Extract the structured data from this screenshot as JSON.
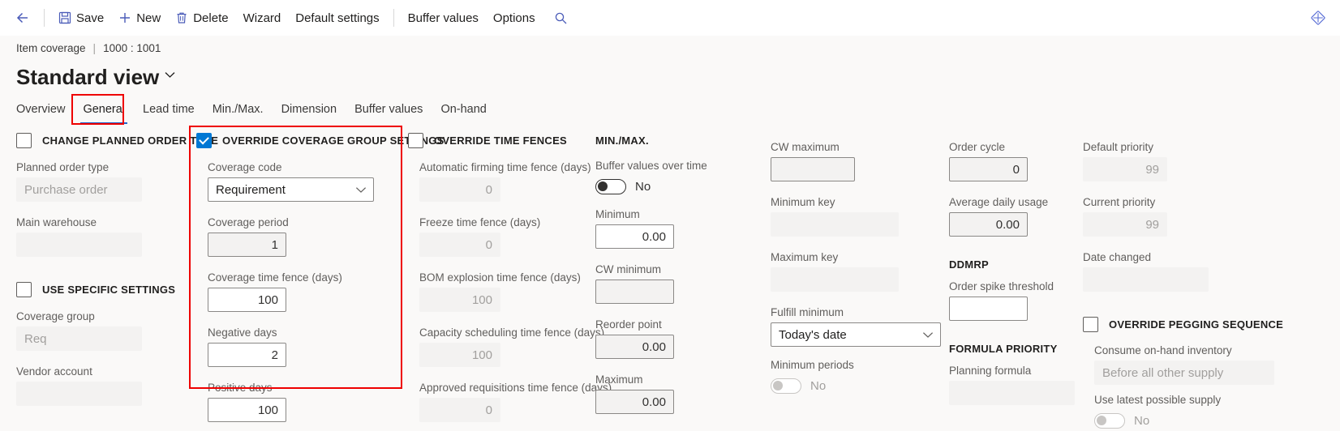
{
  "toolbar": {
    "back_icon": "back-arrow-icon",
    "save_label": "Save",
    "new_label": "New",
    "delete_label": "Delete",
    "wizard_label": "Wizard",
    "default_settings_label": "Default settings",
    "buffer_values_label": "Buffer values",
    "options_label": "Options",
    "search_icon": "search-icon",
    "personalize_icon": "diamond-personalize-icon"
  },
  "header": {
    "breadcrumb_entity": "Item coverage",
    "breadcrumb_sep": "|",
    "breadcrumb_record": "1000 : 1001",
    "page_title": "Standard view",
    "page_title_chevron": "chevron-down-icon"
  },
  "tabs": [
    {
      "label": "Overview",
      "selected": false
    },
    {
      "label": "General",
      "selected": true
    },
    {
      "label": "Lead time",
      "selected": false
    },
    {
      "label": "Min./Max.",
      "selected": false
    },
    {
      "label": "Dimension",
      "selected": false
    },
    {
      "label": "Buffer values",
      "selected": false
    },
    {
      "label": "On-hand",
      "selected": false
    }
  ],
  "col1": {
    "group_title": "CHANGE PLANNED ORDER TYPE",
    "group_checked": false,
    "planned_order_type": {
      "label": "Planned order type",
      "value": "Purchase order"
    },
    "main_warehouse": {
      "label": "Main warehouse",
      "value": ""
    },
    "group2_title": "USE SPECIFIC SETTINGS",
    "group2_checked": false,
    "coverage_group": {
      "label": "Coverage group",
      "value": "Req"
    },
    "vendor_account": {
      "label": "Vendor account",
      "value": ""
    }
  },
  "col2": {
    "group_title": "OVERRIDE COVERAGE GROUP SETTINGS",
    "group_checked": true,
    "coverage_code": {
      "label": "Coverage code",
      "value": "Requirement"
    },
    "coverage_period": {
      "label": "Coverage period",
      "value": "1"
    },
    "coverage_time_fence": {
      "label": "Coverage time fence (days)",
      "value": "100"
    },
    "negative_days": {
      "label": "Negative days",
      "value": "2"
    },
    "positive_days": {
      "label": "Positive days",
      "value": "100"
    }
  },
  "col3": {
    "group_title": "OVERRIDE TIME FENCES",
    "group_checked": false,
    "automatic_firming": {
      "label": "Automatic firming time fence (days)",
      "value": "0"
    },
    "freeze": {
      "label": "Freeze time fence (days)",
      "value": "0"
    },
    "bom_explosion": {
      "label": "BOM explosion time fence (days)",
      "value": "100"
    },
    "capacity_scheduling": {
      "label": "Capacity scheduling time fence (days)",
      "value": "100"
    },
    "approved_requisitions": {
      "label": "Approved requisitions time fence (days)",
      "value": "0"
    }
  },
  "col4": {
    "section_title": "MIN./MAX.",
    "buffer_values_over_time": {
      "label": "Buffer values over time",
      "value": "No"
    },
    "minimum": {
      "label": "Minimum",
      "value": "0.00"
    },
    "cw_minimum": {
      "label": "CW minimum",
      "value": ""
    },
    "reorder_point": {
      "label": "Reorder point",
      "value": "0.00"
    },
    "maximum": {
      "label": "Maximum",
      "value": "0.00"
    }
  },
  "col5": {
    "cw_maximum": {
      "label": "CW maximum",
      "value": ""
    },
    "minimum_key": {
      "label": "Minimum key",
      "value": ""
    },
    "maximum_key": {
      "label": "Maximum key",
      "value": ""
    },
    "fulfill_minimum": {
      "label": "Fulfill minimum",
      "value": "Today's date"
    },
    "minimum_periods": {
      "label": "Minimum periods",
      "value": "No"
    }
  },
  "col6": {
    "order_cycle": {
      "label": "Order cycle",
      "value": "0"
    },
    "average_daily_usage": {
      "label": "Average daily usage",
      "value": "0.00"
    },
    "ddmrp_title": "DDMRP",
    "order_spike_threshold": {
      "label": "Order spike threshold",
      "value": ""
    },
    "formula_priority_title": "FORMULA PRIORITY",
    "planning_formula": {
      "label": "Planning formula",
      "value": ""
    }
  },
  "col7": {
    "default_priority": {
      "label": "Default priority",
      "value": "99"
    },
    "current_priority": {
      "label": "Current priority",
      "value": "99"
    },
    "date_changed": {
      "label": "Date changed",
      "value": ""
    },
    "group_title": "OVERRIDE PEGGING SEQUENCE",
    "group_checked": false,
    "consume_on_hand": {
      "label": "Consume on-hand inventory",
      "value": "Before all other supply"
    },
    "use_latest_possible_supply": {
      "label": "Use latest possible supply",
      "value": "No"
    }
  },
  "colors": {
    "accent": "#0078d4",
    "highlight": "#ee0000",
    "tab_underline": "#2266cc"
  }
}
